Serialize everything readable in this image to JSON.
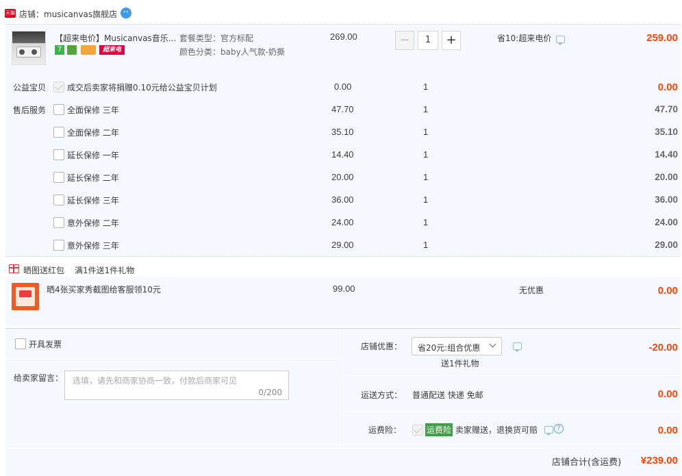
{
  "shop": {
    "badge": "天猫",
    "name": "店铺：musicanvas旗舰店"
  },
  "item": {
    "title": "【超来电价】Musicanvas音乐...",
    "badge_label": "超来电",
    "spec_package": "套餐类型：官方标配",
    "spec_color": "颜色分类：baby人气款-奶撕",
    "unit_price": "269.00",
    "quantity": "1",
    "promo": "省10:超来电价",
    "total": "259.00"
  },
  "charity": {
    "section_label": "公益宝贝",
    "text": "成交后卖家将捐赠0.10元给公益宝贝计划",
    "price": "0.00",
    "qty": "1",
    "total": "0.00"
  },
  "after_sales": {
    "section_label": "售后服务",
    "rows": [
      {
        "label": "全面保修 三年",
        "price": "47.70",
        "qty": "1",
        "total": "47.70"
      },
      {
        "label": "全面保修 二年",
        "price": "35.10",
        "qty": "1",
        "total": "35.10"
      },
      {
        "label": "延长保修 一年",
        "price": "14.40",
        "qty": "1",
        "total": "14.40"
      },
      {
        "label": "延长保修 二年",
        "price": "20.00",
        "qty": "1",
        "total": "20.00"
      },
      {
        "label": "延长保修 三年",
        "price": "36.00",
        "qty": "1",
        "total": "36.00"
      },
      {
        "label": "意外保修 二年",
        "price": "24.00",
        "qty": "1",
        "total": "24.00"
      },
      {
        "label": "意外保修 三年",
        "price": "29.00",
        "qty": "1",
        "total": "29.00"
      }
    ]
  },
  "gift": {
    "header_label": "晒图送红包",
    "header_note": "满1件送1件礼物",
    "title": "晒4张买家秀截图给客服领10元",
    "price": "99.00",
    "promo": "无优惠",
    "total": "0.00"
  },
  "order": {
    "invoice_label": "开具发票",
    "message_label": "给卖家留言：",
    "message_placeholder": "选填，请先和商家协商一致，付款后商家可见",
    "message_counter": "0/200",
    "shop_discount_label": "店铺优惠：",
    "shop_discount_select": "省20元:组合优惠",
    "shop_discount_note": "送1件礼物",
    "shop_discount_value": "-20.00",
    "shipping_label": "运送方式：",
    "shipping_method": "普通配送 快递 免邮",
    "shipping_value": "0.00",
    "insurance_label": "运费险：",
    "insurance_tag": "运费险",
    "insurance_text": "卖家赠送，退换货可赔",
    "insurance_value": "0.00",
    "total_label": "店铺合计(含运费)",
    "total_value": "¥239.00"
  }
}
